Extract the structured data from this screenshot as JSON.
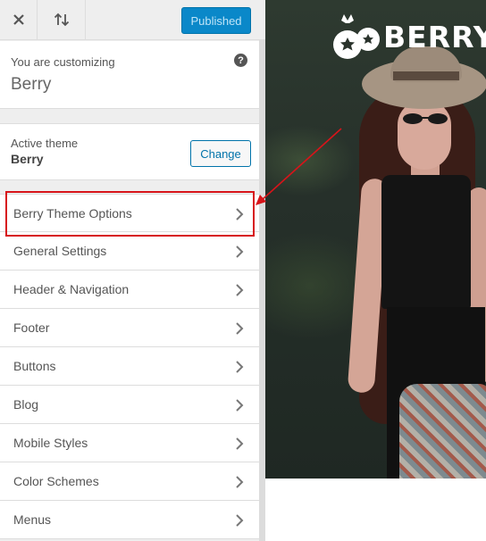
{
  "topbar": {
    "close_icon": "close-icon",
    "reorder_icon": "arrows-up-down-icon",
    "publish_label": "Published",
    "publish_color": "#0a88c9"
  },
  "info": {
    "customizing_label": "You are customizing",
    "site_title": "Berry",
    "help_icon": "?"
  },
  "theme": {
    "active_label": "Active theme",
    "name": "Berry",
    "change_label": "Change"
  },
  "menu": {
    "items": [
      {
        "label": "Berry Theme Options",
        "icon": "chevron-right-icon"
      },
      {
        "label": "General Settings",
        "icon": "chevron-right-icon"
      },
      {
        "label": "Header & Navigation",
        "icon": "chevron-right-icon"
      },
      {
        "label": "Footer",
        "icon": "chevron-right-icon"
      },
      {
        "label": "Buttons",
        "icon": "chevron-right-icon"
      },
      {
        "label": "Blog",
        "icon": "chevron-right-icon"
      },
      {
        "label": "Mobile Styles",
        "icon": "chevron-right-icon"
      },
      {
        "label": "Color Schemes",
        "icon": "chevron-right-icon"
      },
      {
        "label": "Menus",
        "icon": "chevron-right-icon"
      }
    ],
    "highlighted": "Berry Theme Options",
    "highlight_color": "#d7141a"
  },
  "preview": {
    "brand": "BERRY",
    "brand_icon": "berry-logo-icon"
  }
}
